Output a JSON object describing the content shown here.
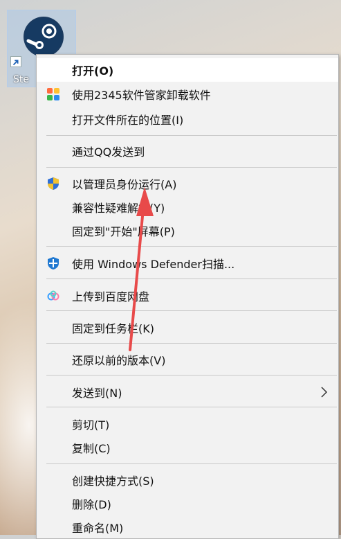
{
  "desktop": {
    "shortcut_label": "Ste"
  },
  "menu": {
    "items": [
      {
        "label": "打开(O)"
      },
      {
        "label": "使用2345软件管家卸载软件"
      },
      {
        "label": "打开文件所在的位置(I)"
      },
      {
        "label": "通过QQ发送到"
      },
      {
        "label": "以管理员身份运行(A)"
      },
      {
        "label": "兼容性疑难解答(Y)"
      },
      {
        "label": "固定到\"开始\"屏幕(P)"
      },
      {
        "label": "使用 Windows Defender扫描..."
      },
      {
        "label": "上传到百度网盘"
      },
      {
        "label": "固定到任务栏(K)"
      },
      {
        "label": "还原以前的版本(V)"
      },
      {
        "label": "发送到(N)"
      },
      {
        "label": "剪切(T)"
      },
      {
        "label": "复制(C)"
      },
      {
        "label": "创建快捷方式(S)"
      },
      {
        "label": "删除(D)"
      },
      {
        "label": "重命名(M)"
      }
    ]
  },
  "colors": {
    "menu_bg": "#f2f2f2",
    "annotation_arrow": "#e84a4a",
    "shield_blue": "#2f6fd6",
    "shield_yellow": "#f2c230"
  },
  "icons": [
    "steam-icon",
    "shortcut-arrow-icon",
    "app-manager-icon",
    "uac-shield-icon",
    "defender-shield-icon",
    "baidu-netdisk-icon",
    "chevron-right-icon"
  ]
}
